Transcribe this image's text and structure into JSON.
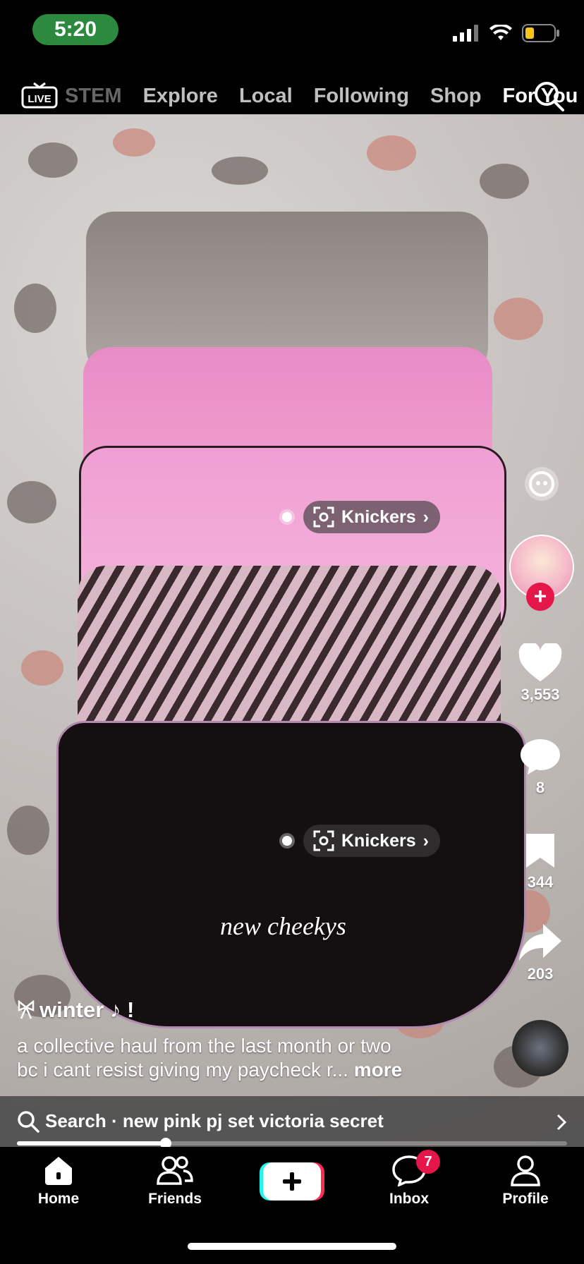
{
  "status_bar": {
    "time": "5:20"
  },
  "top_nav": {
    "live_label": "LIVE",
    "tabs": [
      "STEM",
      "Explore",
      "Local",
      "Following",
      "Shop",
      "For You"
    ],
    "active_tab": "For You"
  },
  "video": {
    "overlay_text": "new cheekys",
    "product_tags": [
      {
        "label": "Knickers"
      },
      {
        "label": "Knickers"
      }
    ]
  },
  "actions": {
    "likes": "3,553",
    "comments": "8",
    "saves": "344",
    "shares": "203"
  },
  "post": {
    "username": "winter ♪ !",
    "description_line1": "a collective haul from the last month or two",
    "description_line2": "bc i cant resist giving my paycheck r...",
    "more_label": "more",
    "progress": 0.27
  },
  "search_suggestion": "Search · new pink pj set victoria secret",
  "bottom_nav": {
    "items": [
      "Home",
      "Friends",
      "Inbox",
      "Profile"
    ],
    "inbox_badge": "7"
  },
  "colors": {
    "accent_red": "#e5164a",
    "time_pill": "#2b8a3e"
  }
}
